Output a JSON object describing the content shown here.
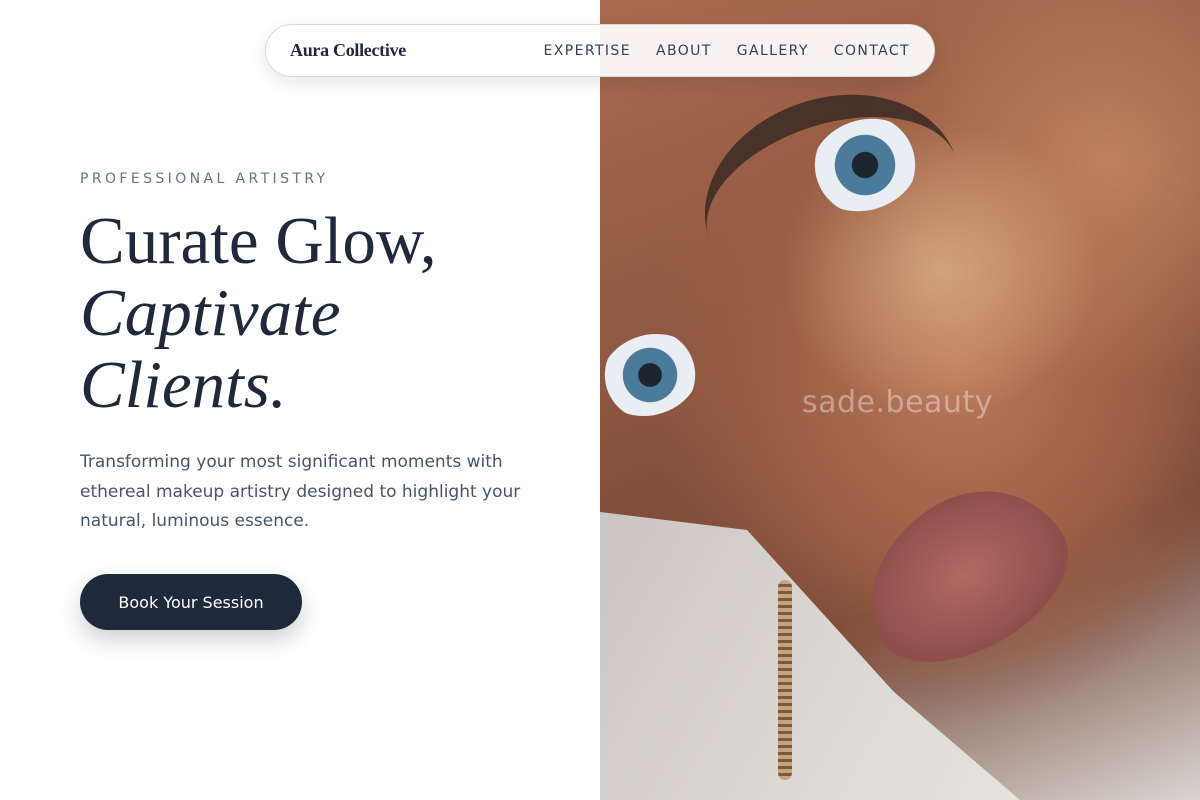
{
  "nav": {
    "brand": "Aura Collective",
    "links": [
      "EXPERTISE",
      "ABOUT",
      "GALLERY",
      "CONTACT"
    ]
  },
  "hero": {
    "eyebrow": "PROFESSIONAL ARTISTRY",
    "headline_line1": "Curate Glow,",
    "headline_line2": "Captivate",
    "headline_line3": "Clients.",
    "subtitle": "Transforming your most significant moments with ethereal makeup artistry designed to highlight your natural, luminous essence.",
    "cta_label": "Book Your Session"
  },
  "photo": {
    "watermark": "sade.beauty"
  },
  "colors": {
    "primary": "#1e293b",
    "muted_text": "#64748b",
    "body_text": "#475569"
  }
}
